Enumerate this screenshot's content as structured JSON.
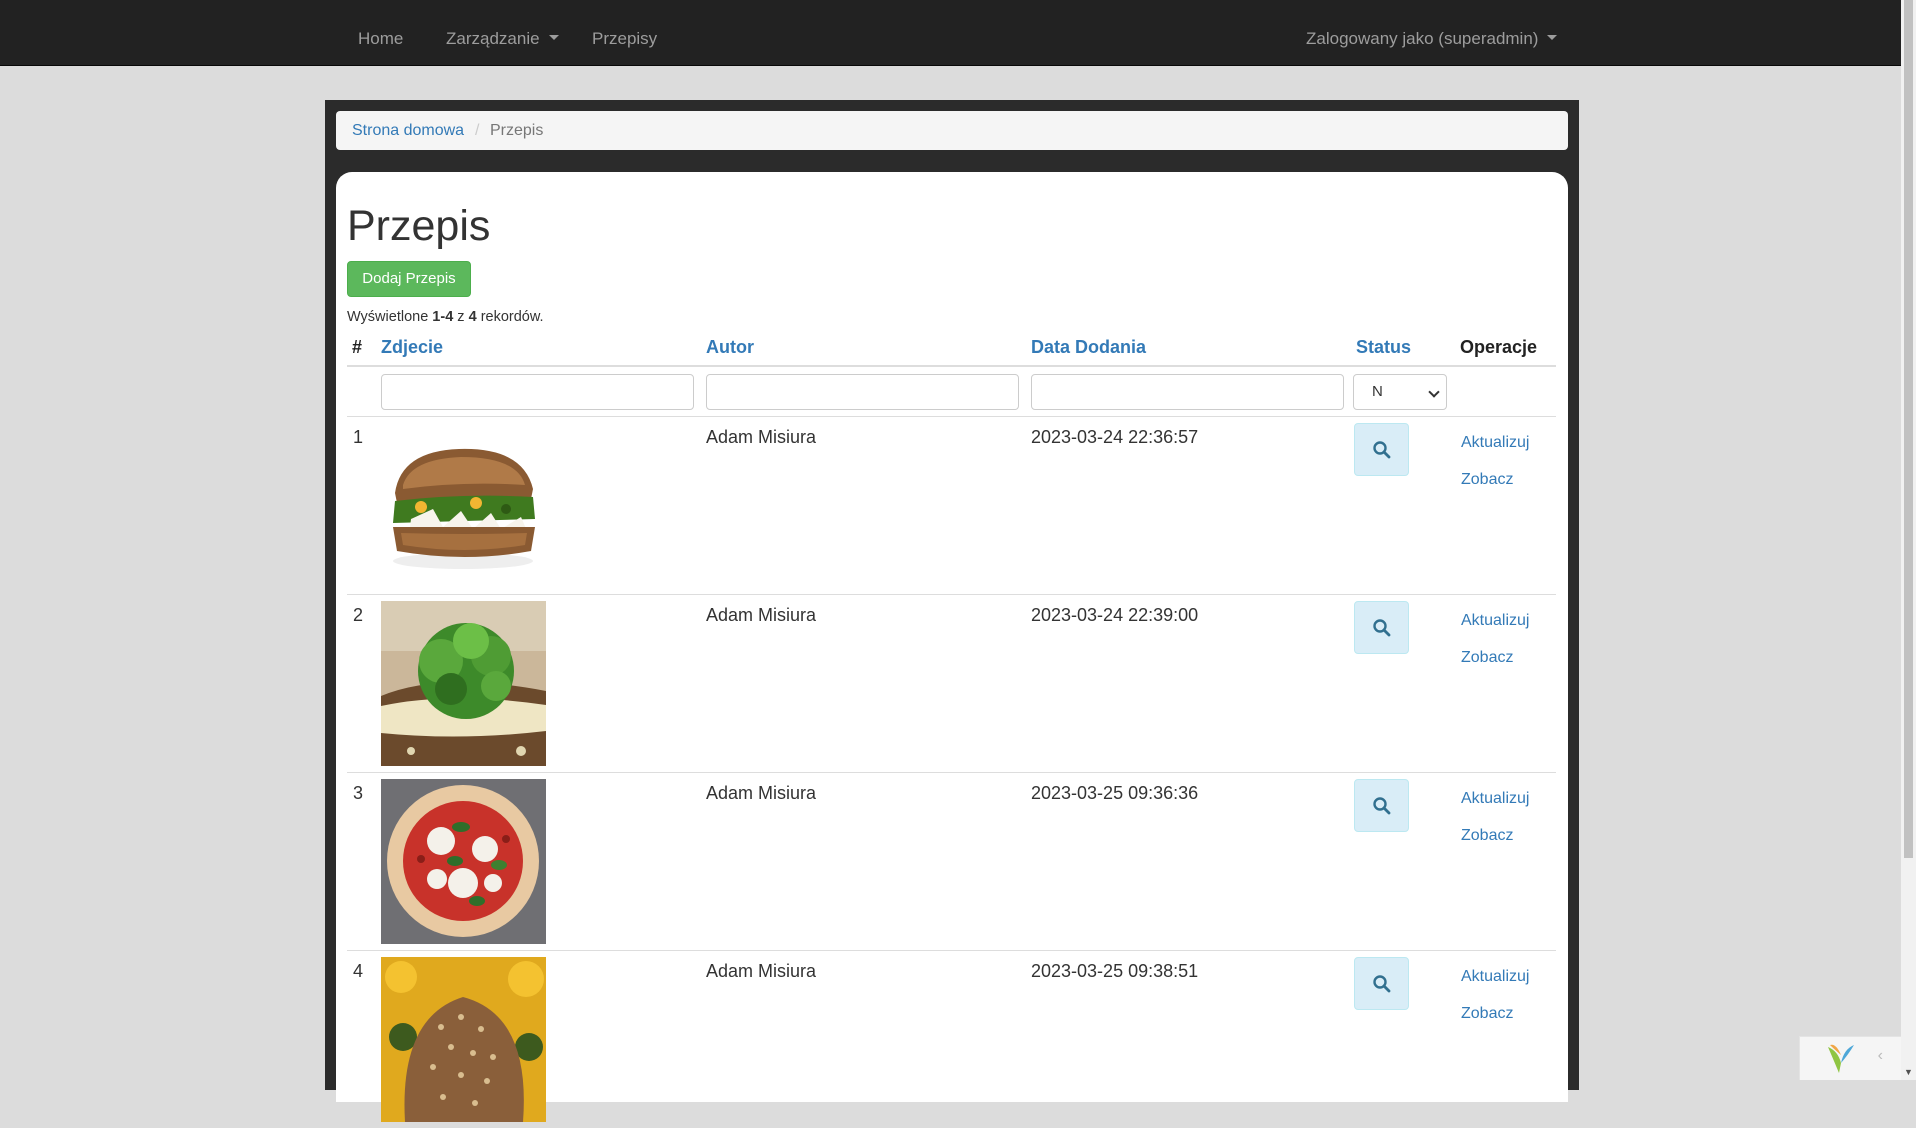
{
  "navbar": {
    "home": "Home",
    "management": "Zarządzanie",
    "recipes": "Przepisy",
    "user": "Zalogowany jako (superadmin)"
  },
  "breadcrumb": {
    "home": "Strona domowa",
    "separator": "/",
    "current": "Przepis"
  },
  "page": {
    "title": "Przepis",
    "add_button": "Dodaj Przepis"
  },
  "summary": {
    "prefix": "Wyświetlone",
    "range": "1-4",
    "middle": "z",
    "total": "4",
    "suffix": "rekordów."
  },
  "table": {
    "headers": {
      "number": "#",
      "photo": "Zdjecie",
      "author": "Autor",
      "date": "Data Dodania",
      "status": "Status",
      "operations": "Operacje"
    },
    "status_filter": "N",
    "rows": [
      {
        "num": "1",
        "photo": "sandwich-photo",
        "author": "Adam Misiura",
        "date": "2023-03-24 22:36:57",
        "update": "Aktualizuj",
        "view": "Zobacz"
      },
      {
        "num": "2",
        "photo": "green-bread-photo",
        "author": "Adam Misiura",
        "date": "2023-03-24 22:39:00",
        "update": "Aktualizuj",
        "view": "Zobacz"
      },
      {
        "num": "3",
        "photo": "pizza-photo",
        "author": "Adam Misiura",
        "date": "2023-03-25 09:36:36",
        "update": "Aktualizuj",
        "view": "Zobacz"
      },
      {
        "num": "4",
        "photo": "seed-bread-photo",
        "author": "Adam Misiura",
        "date": "2023-03-25 09:38:51",
        "update": "Aktualizuj",
        "view": "Zobacz"
      }
    ]
  },
  "colors": {
    "navbar": "#222222",
    "link": "#337ab7",
    "success": "#5cb85c",
    "info_bg": "#d9edf7"
  }
}
